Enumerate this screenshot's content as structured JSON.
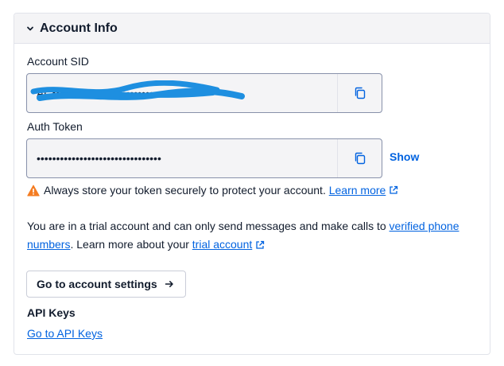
{
  "panel": {
    "title": "Account Info"
  },
  "account_sid": {
    "label": "Account SID",
    "value": "AC••••••••••••••••••••••••••••••••"
  },
  "auth_token": {
    "label": "Auth Token",
    "value": "••••••••••••••••••••••••••••••••",
    "show_label": "Show"
  },
  "warning": {
    "text": "Always store your token securely to protect your account.",
    "link_label": "Learn more"
  },
  "trial": {
    "text_before": "You are in a trial account and can only send messages and make calls to ",
    "link1_label": "verified phone numbers",
    "text_middle": ". Learn more about your ",
    "link2_label": "trial account"
  },
  "settings_button": {
    "label": "Go to account settings"
  },
  "api_keys": {
    "heading": "API Keys",
    "link_label": "Go to API Keys"
  },
  "colors": {
    "link": "#0263e0",
    "warning": "#f47c22",
    "redaction": "#1e8fe0"
  }
}
